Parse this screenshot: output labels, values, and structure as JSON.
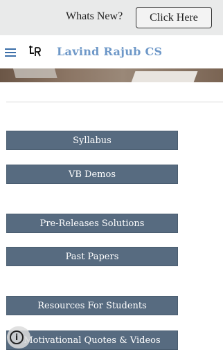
{
  "topbar": {
    "whats_new": "Whats New?",
    "click_here": "Click Here"
  },
  "header": {
    "title": "Lavind Rajub CS",
    "logo_text": "LR",
    "menu_icon": "hamburger-icon"
  },
  "nav": {
    "syllabus": "Syllabus",
    "vb_demos": "VB Demos",
    "pre_releases": "Pre-Releases Solutions",
    "past_papers": "Past Papers",
    "resources": "Resources For Students",
    "motivational": "Motivational Quotes & Videos"
  },
  "info_icon": "info-icon",
  "colors": {
    "accent": "#576b80",
    "title": "#6e98c8",
    "topbar_bg": "#e9eaea"
  }
}
